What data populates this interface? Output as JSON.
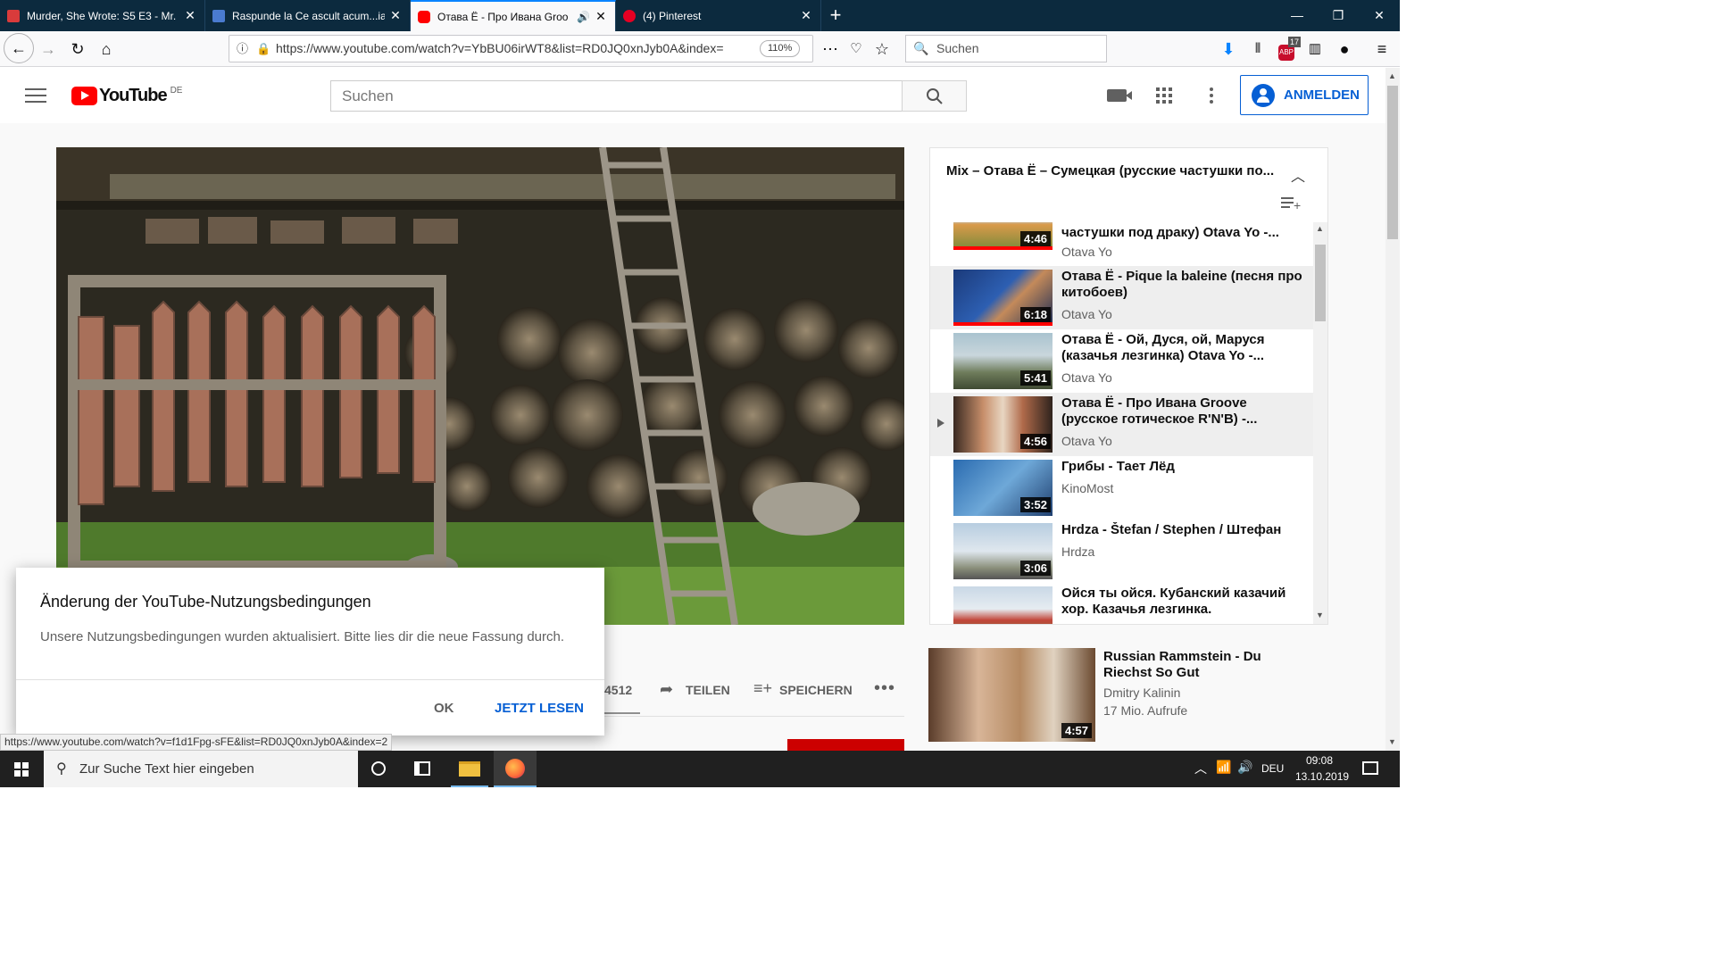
{
  "browser": {
    "tabs": [
      {
        "title": "Murder, She Wrote: S5 E3 - Mr.",
        "fav_color": "#d93b3b"
      },
      {
        "title": "Raspunde la Ce ascult acum...ia",
        "fav_color": "#4a7bd0"
      },
      {
        "title": "Отава Ё - Про Ивана Groo",
        "fav_color": "#ff0000"
      },
      {
        "title": "(4) Pinterest",
        "fav_color": "#e60023"
      }
    ],
    "active_tab_index": 2,
    "url": "https://www.youtube.com/watch?v=YbBU06irWT8&list=RD0JQ0xnJyb0A&index=",
    "zoom": "110%",
    "search_placeholder": "Suchen",
    "abp_count": "17"
  },
  "youtube": {
    "logo_text": "YouTube",
    "region": "DE",
    "search_placeholder": "Suchen",
    "signin_label": "ANMELDEN"
  },
  "playlist": {
    "title": "Mix – Отава Ё – Сумецкая (русские частушки по...",
    "items": [
      {
        "title": "частушки под драку) Otava Yo -...",
        "channel": "Otava Yo",
        "duration": "4:46",
        "highlight": false,
        "playing": false
      },
      {
        "title": "Отава Ё - Pique la baleine (песня про китобоев)",
        "channel": "Otava Yo",
        "duration": "6:18",
        "highlight": true,
        "playing": false
      },
      {
        "title": "Отава Ё - Ой, Дуся, ой, Маруся (казачья лезгинка) Otava Yo -...",
        "channel": "Otava Yo",
        "duration": "5:41",
        "highlight": false,
        "playing": false
      },
      {
        "title": "Отава Ё - Про Ивана Groove (русское готическое R'N'B) -...",
        "channel": "Otava Yo",
        "duration": "4:56",
        "highlight": true,
        "playing": true
      },
      {
        "title": "Грибы - Тает Лёд",
        "channel": "KinoMost",
        "duration": "3:52",
        "highlight": false,
        "playing": false
      },
      {
        "title": "Hrdza - Štefan / Stephen / Штефан",
        "channel": "Hrdza",
        "duration": "3:06",
        "highlight": false,
        "playing": false
      },
      {
        "title": "Ойся ты ойся. Кубанский казачий хор. Казачья лезгинка.",
        "channel": "",
        "duration": "",
        "highlight": false,
        "playing": false
      }
    ]
  },
  "actions": {
    "likes": "4512",
    "share": "TEILEN",
    "save": "SPEICHERN"
  },
  "recommended": {
    "title": "Russian Rammstein - Du Riechst So Gut",
    "channel": "Dmitry Kalinin",
    "views": "17 Mio. Aufrufe",
    "duration": "4:57"
  },
  "dialog": {
    "title": "Änderung der YouTube-Nutzungsbedingungen",
    "body": "Unsere Nutzungsbedingungen wurden aktualisiert. Bitte lies dir die neue Fassung durch.",
    "ok": "OK",
    "read": "JETZT LESEN"
  },
  "status_url": "https://www.youtube.com/watch?v=f1d1Fpg-sFE&list=RD0JQ0xnJyb0A&index=2",
  "taskbar": {
    "search_placeholder": "Zur Suche Text hier eingeben",
    "lang": "DEU",
    "time": "09:08",
    "date": "13.10.2019"
  }
}
